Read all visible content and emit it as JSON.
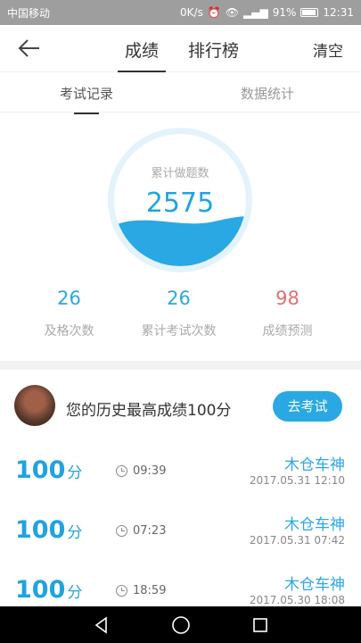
{
  "status": {
    "carrier": "中国移动",
    "net": "0K/s",
    "battery": "91%",
    "time": "12:31"
  },
  "header": {
    "tabs": [
      "成绩",
      "排行榜"
    ],
    "clear_label": "清空"
  },
  "subtabs": [
    "考试记录",
    "数据统计"
  ],
  "summary": {
    "label": "累计做题数",
    "value": "2575",
    "fill_fraction": 0.35
  },
  "stats": [
    {
      "value": "26",
      "label": "及格次数"
    },
    {
      "value": "26",
      "label": "累计考试次数"
    },
    {
      "value": "98",
      "label": "成绩预测"
    }
  ],
  "best": {
    "text": "您的历史最高成绩100分",
    "button_label": "去考试"
  },
  "records": [
    {
      "score": "100",
      "unit": "分",
      "duration": "09:39",
      "name": "木仓车神",
      "date": "2017.05.31  12:10"
    },
    {
      "score": "100",
      "unit": "分",
      "duration": "07:23",
      "name": "木仓车神",
      "date": "2017.05.31  07:42"
    },
    {
      "score": "100",
      "unit": "分",
      "duration": "18:59",
      "name": "木仓车神",
      "date": "2017.05.30  18:08"
    }
  ]
}
